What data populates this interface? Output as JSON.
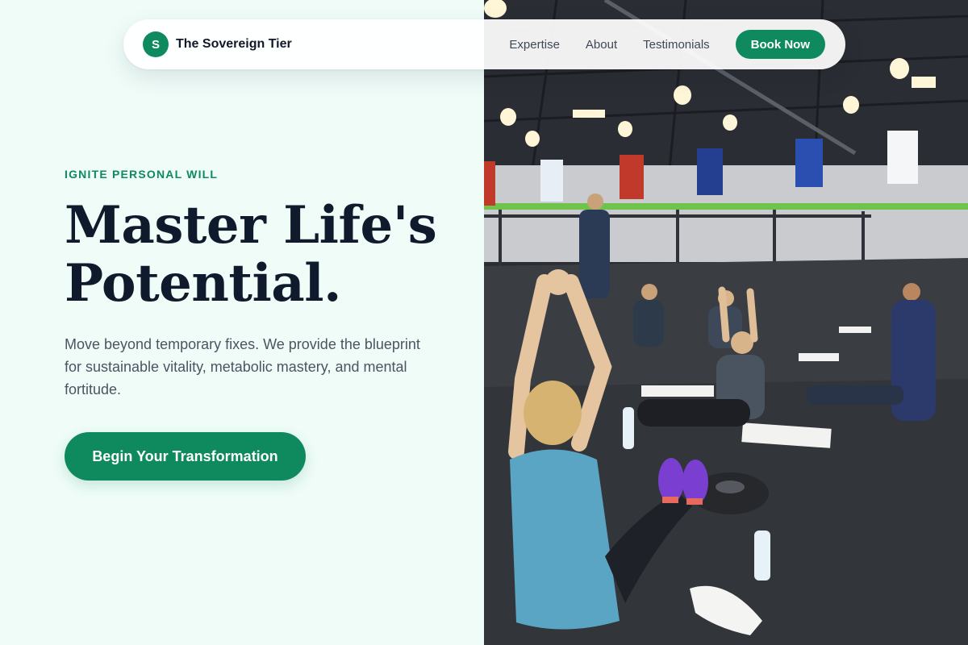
{
  "brand": {
    "mark": "S",
    "name": "The Sovereign Tier"
  },
  "nav": {
    "links": [
      "Expertise",
      "About",
      "Testimonials"
    ],
    "cta": "Book Now"
  },
  "hero": {
    "eyebrow": "IGNITE PERSONAL WILL",
    "headline_line1": "Master Life's",
    "headline_line2": "Potential.",
    "subtext": "Move beyond temporary fixes. We provide the blueprint for sustainable vitality, metabolic mastery, and mental fortitude.",
    "cta": "Begin Your Transformation",
    "image_alt": "Group fitness class stretching on mats in a large gym"
  },
  "colors": {
    "accent": "#0f8a5f",
    "background": "#effcf8",
    "heading": "#0f1b2d",
    "body_text": "#4a5563"
  }
}
